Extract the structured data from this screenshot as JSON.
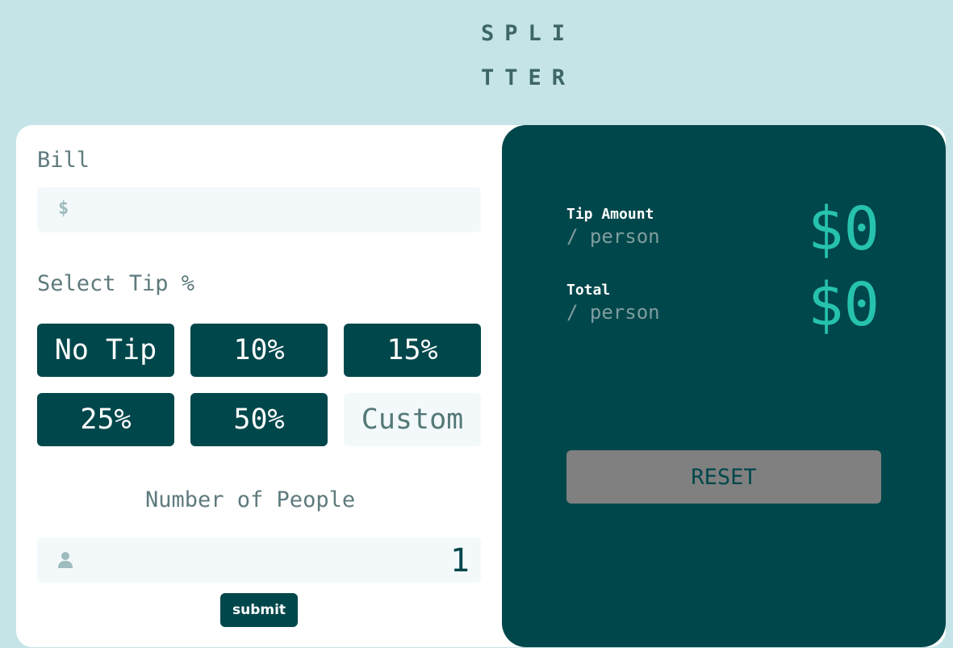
{
  "logo": {
    "line1": "SPLI",
    "line2": "TTER"
  },
  "bill": {
    "label": "Bill",
    "prefix": "$",
    "value": ""
  },
  "tip": {
    "label": "Select Tip %",
    "options": [
      "No Tip",
      "10%",
      "15%",
      "25%",
      "50%"
    ],
    "custom_placeholder": "Custom"
  },
  "people": {
    "label": "Number of People",
    "value": "1"
  },
  "submit_label": "submit",
  "results": {
    "tip_amount": {
      "title": "Tip Amount",
      "sub": "/ person",
      "value": "$0"
    },
    "total": {
      "title": "Total",
      "sub": "/ person",
      "value": "$0"
    },
    "reset_label": "RESET"
  },
  "colors": {
    "background": "#c5e4e7",
    "dark_cyan": "#00474b",
    "accent_cyan": "#26c2ad",
    "input_bg": "#f3f9fa"
  },
  "icons": {
    "person": "person-icon"
  }
}
